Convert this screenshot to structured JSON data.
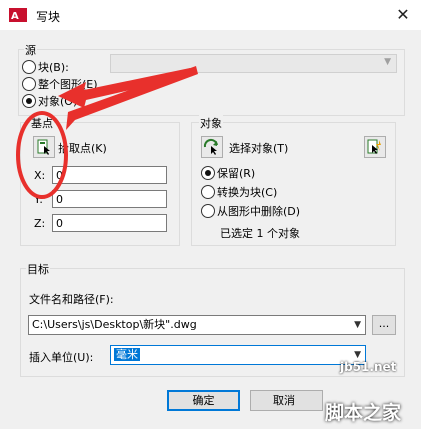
{
  "window": {
    "title": "写块",
    "close_glyph": "✕"
  },
  "source": {
    "label": "源",
    "options": [
      {
        "label": "块(B):",
        "selected": false
      },
      {
        "label": "整个图形(E)",
        "selected": false
      },
      {
        "label": "对象(O)",
        "selected": true
      }
    ],
    "block_combo_value": ""
  },
  "base_point": {
    "label": "基点",
    "pick_label": "拾取点(K)",
    "x_label": "X:",
    "x_value": "0",
    "y_label": "Y:",
    "y_value": "0",
    "z_label": "Z:",
    "z_value": "0"
  },
  "objects": {
    "label": "对象",
    "select_label": "选择对象(T)",
    "options": [
      {
        "label": "保留(R)",
        "selected": true
      },
      {
        "label": "转换为块(C)",
        "selected": false
      },
      {
        "label": "从图形中删除(D)",
        "selected": false
      }
    ],
    "status": "已选定 1 个对象"
  },
  "target": {
    "label": "目标",
    "path_label": "文件名和路径(F):",
    "path_value": "C:\\Users\\js\\Desktop\\新块\".dwg",
    "browse_label": "...",
    "units_label": "插入单位(U):",
    "units_value": "毫米"
  },
  "buttons": {
    "ok": "确定",
    "cancel": "取消"
  },
  "watermark": {
    "line1": "jb51.net",
    "line2": "脚本之家"
  },
  "annotation_color": "#e8302c"
}
